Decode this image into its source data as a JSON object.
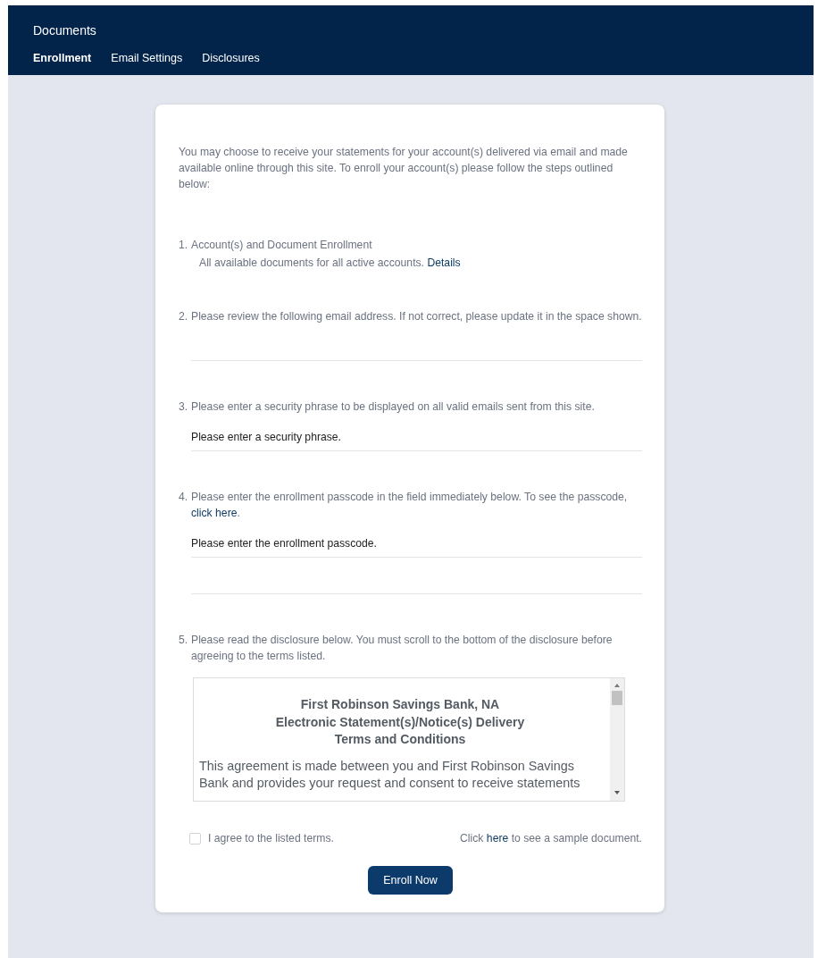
{
  "header": {
    "title": "Documents"
  },
  "tabs": [
    {
      "label": "Enrollment",
      "selected": true
    },
    {
      "label": "Email Settings",
      "selected": false
    },
    {
      "label": "Disclosures",
      "selected": false
    }
  ],
  "intro": "You may choose to receive your statements for your account(s) delivered via email and made available online through this site. To enroll your account(s) please follow the steps outlined below:",
  "steps": [
    {
      "number": "1.",
      "text": "Account(s) and Document Enrollment",
      "detail": "All available documents for all active accounts.",
      "detail_link": "Details"
    },
    {
      "number": "2.",
      "text": "Please review the following email address. If not correct, please update it in the space shown.",
      "fields": [
        {
          "kind": "input"
        }
      ]
    },
    {
      "number": "3.",
      "text": "Please enter a security phrase to be displayed on all valid emails sent from this site.",
      "fields": [
        {
          "kind": "input",
          "placeholder": "Please enter a security phrase."
        }
      ]
    },
    {
      "number": "4.",
      "text": "Please enter the enrollment passcode in the field immediately below. To see the passcode,",
      "link": "click here",
      "text_after": ".",
      "fields": [
        {
          "kind": "input",
          "placeholder": "Please enter the enrollment passcode."
        },
        {
          "kind": "input"
        }
      ]
    },
    {
      "number": "5.",
      "text": "Please read the disclosure below. You must scroll to the bottom of the disclosure before agreeing to the terms listed.",
      "disclosure": {
        "heading": [
          "First Robinson Savings Bank, NA",
          "Electronic Statement(s)/Notice(s) Delivery",
          "Terms and Conditions"
        ],
        "body": "This agreement is made between you and First Robinson Savings Bank and provides your request and consent to receive statements"
      }
    }
  ],
  "agree": {
    "label": "I agree to the listed terms.",
    "checked": false
  },
  "sample": {
    "before": "Click",
    "link": "here",
    "after": "to see a sample document."
  },
  "button": "Enroll Now"
}
